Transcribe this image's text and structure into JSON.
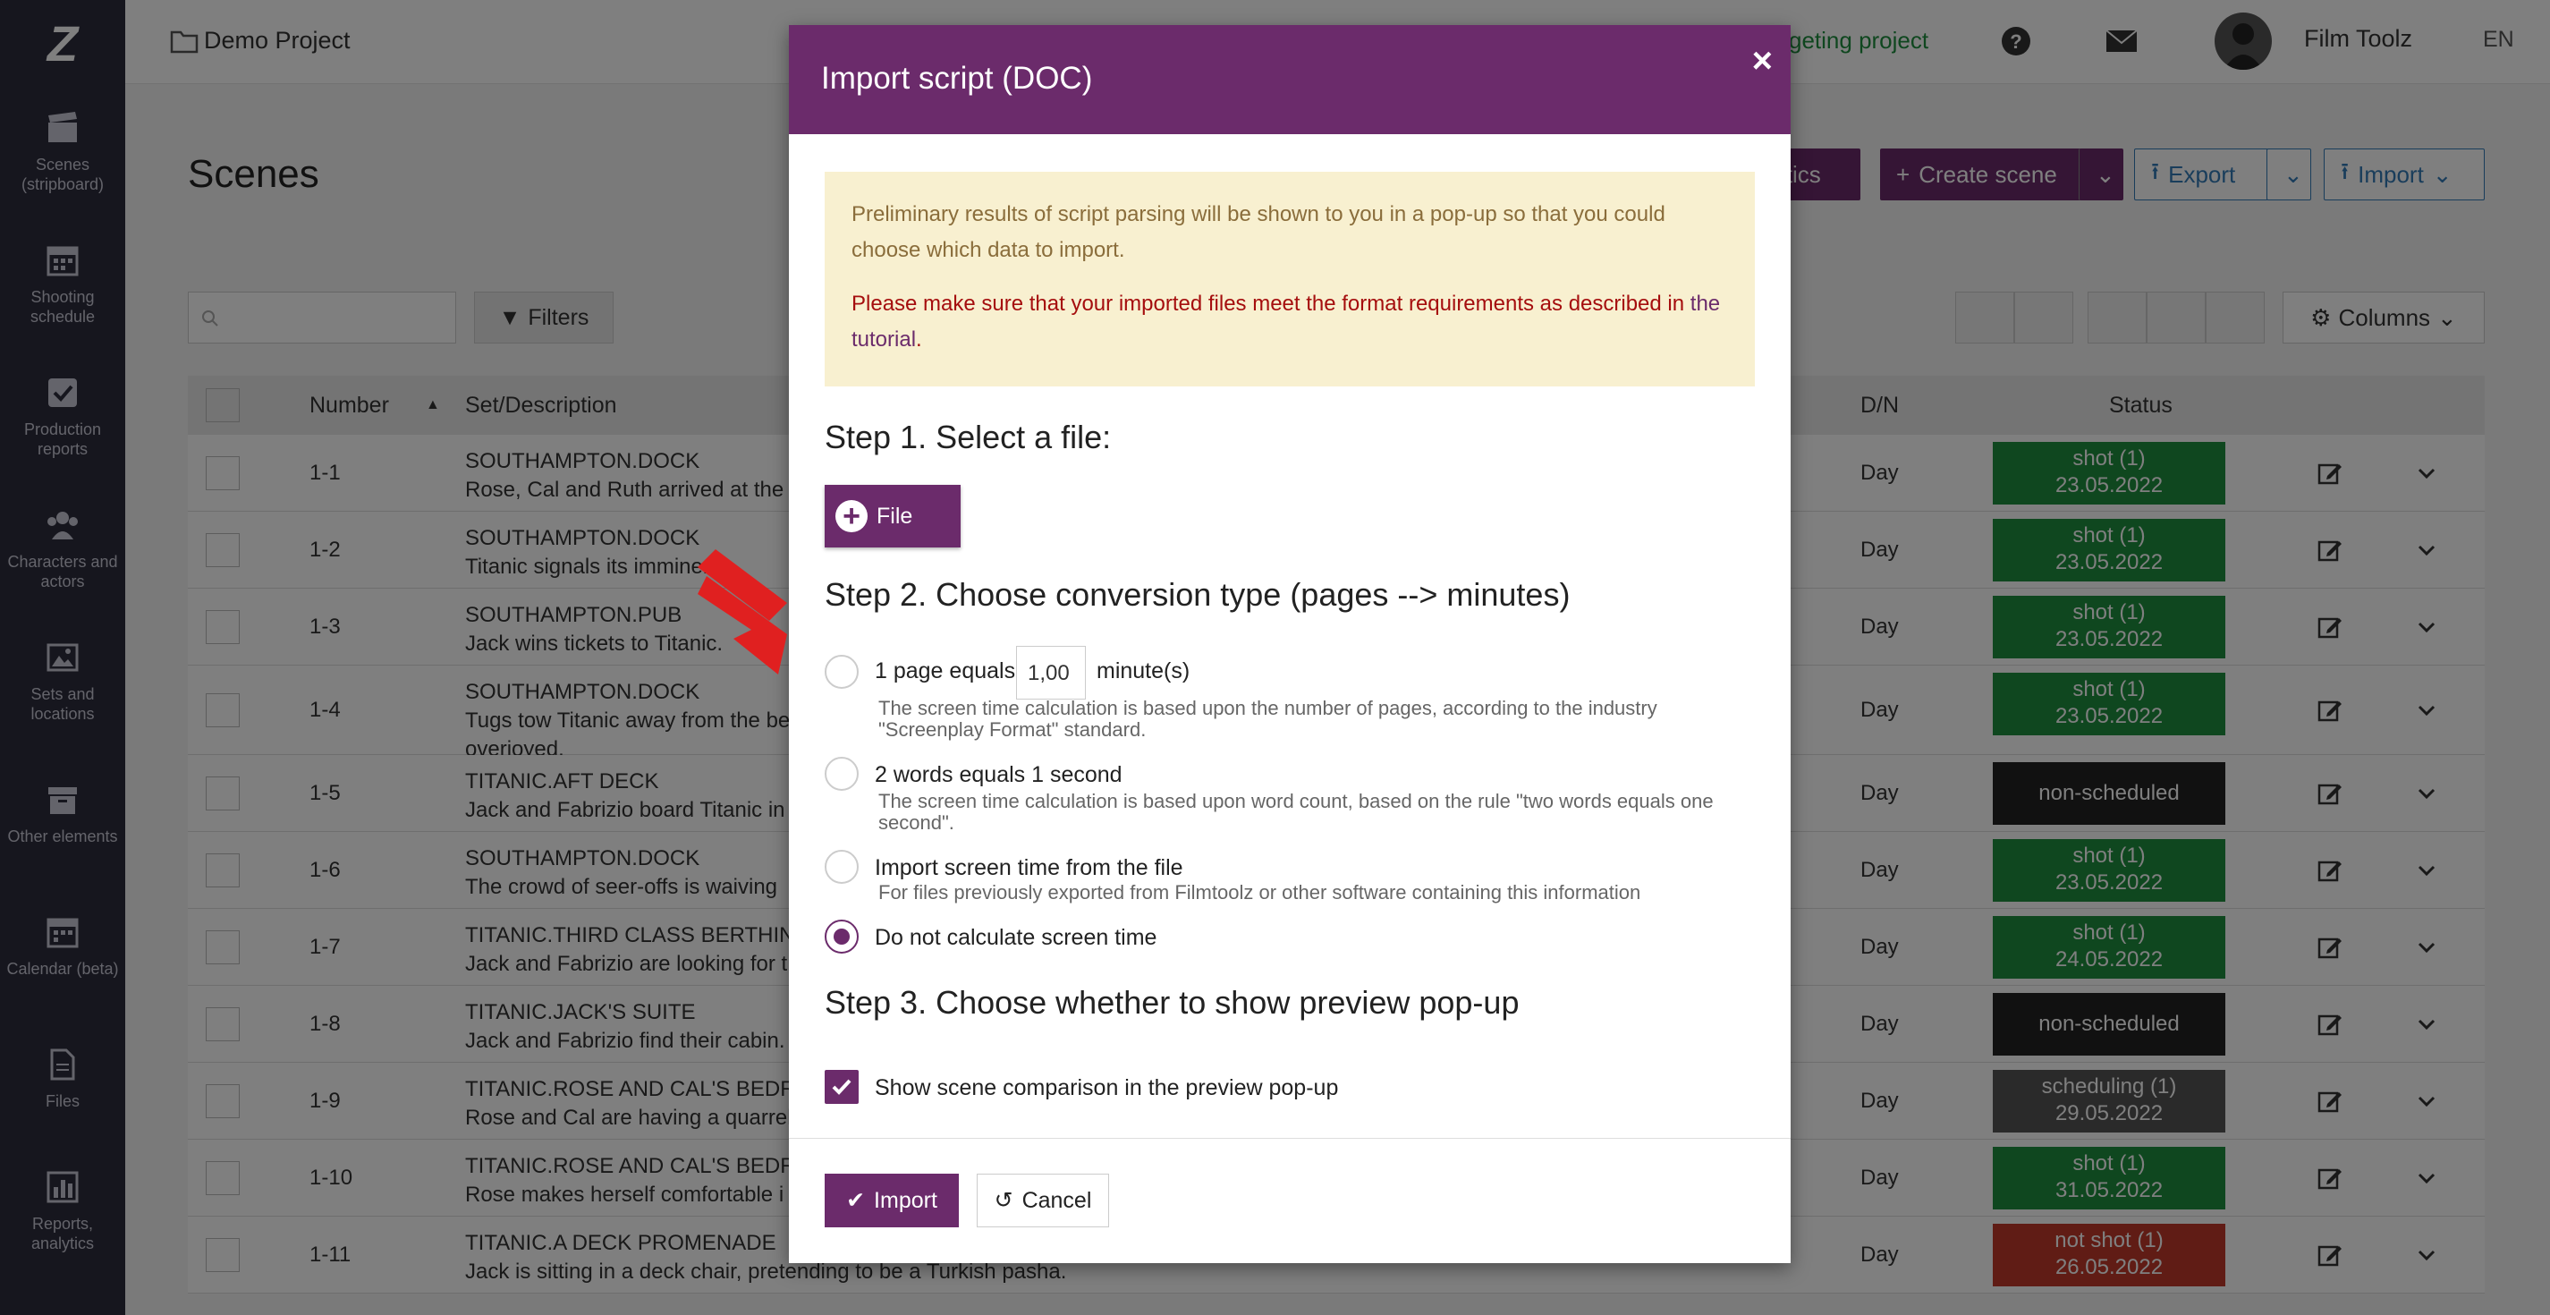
{
  "sidebar": {
    "logo": "Z",
    "items": [
      {
        "label": "Scenes (stripboard)",
        "icon": "clapperboard-icon"
      },
      {
        "label": "Shooting schedule",
        "icon": "calendar-icon"
      },
      {
        "label": "Production reports",
        "icon": "checkbox-icon"
      },
      {
        "label": "Characters and actors",
        "icon": "people-icon"
      },
      {
        "label": "Sets and locations",
        "icon": "picture-icon"
      },
      {
        "label": "Other elements",
        "icon": "archive-icon"
      },
      {
        "label": "Calendar (beta)",
        "icon": "calendar-icon"
      },
      {
        "label": "Files",
        "icon": "file-icon"
      },
      {
        "label": "Reports, analytics",
        "icon": "bar-chart-icon"
      }
    ]
  },
  "topbar": {
    "project": "Demo Project",
    "budget": "geting project",
    "user": "Film Toolz",
    "lang": "EN"
  },
  "main": {
    "title": "Scenes",
    "analytics_label": "lytics",
    "create_label": "Create scene",
    "export_label": "Export",
    "import_label": "Import",
    "filters_label": "Filters",
    "columns_label": "Columns",
    "headers": {
      "number": "Number",
      "set": "Set/Description",
      "dn": "D/N",
      "status": "Status"
    },
    "rows": [
      {
        "num": "1-1",
        "set": "SOUTHAMPTON.DOCK",
        "desc": "Rose, Cal and Ruth arrived at the b",
        "desc2": "",
        "dn": "Day",
        "status": "shot (1)",
        "date": "23.05.2022",
        "kind": "shot"
      },
      {
        "num": "1-2",
        "set": "SOUTHAMPTON.DOCK",
        "desc": "Titanic signals its imminent",
        "desc2": "",
        "dn": "Day",
        "status": "shot (1)",
        "date": "23.05.2022",
        "kind": "shot"
      },
      {
        "num": "1-3",
        "set": "SOUTHAMPTON.PUB",
        "desc": "Jack wins tickets to Titanic.",
        "desc2": "",
        "dn": "Day",
        "status": "shot (1)",
        "date": "23.05.2022",
        "kind": "shot"
      },
      {
        "num": "1-4",
        "set": "SOUTHAMPTON.DOCK",
        "desc": "Tugs tow Titanic away from the be",
        "desc2": "overjoyed.",
        "dn": "Day",
        "status": "shot (1)",
        "date": "23.05.2022",
        "kind": "shot"
      },
      {
        "num": "1-5",
        "set": "TITANIC.AFT DECK",
        "desc": "Jack and Fabrizio board Titanic in",
        "desc2": "",
        "dn": "Day",
        "status": "non-scheduled",
        "date": "",
        "kind": "non"
      },
      {
        "num": "1-6",
        "set": "SOUTHAMPTON.DOCK",
        "desc": "The crowd of seer-offs is waiving",
        "desc2": "",
        "dn": "Day",
        "status": "shot (1)",
        "date": "23.05.2022",
        "kind": "shot"
      },
      {
        "num": "1-7",
        "set": "TITANIC.THIRD CLASS BERTHING",
        "desc": "Jack and Fabrizio are looking for t",
        "desc2": "",
        "dn": "Day",
        "status": "shot (1)",
        "date": "24.05.2022",
        "kind": "shot"
      },
      {
        "num": "1-8",
        "set": "TITANIC.JACK'S SUITE",
        "desc": "Jack and Fabrizio find their cabin.",
        "desc2": "",
        "dn": "Day",
        "status": "non-scheduled",
        "date": "",
        "kind": "non"
      },
      {
        "num": "1-9",
        "set": "TITANIC.ROSE AND CAL'S BEDRO",
        "desc": "Rose and Cal are having a quarrel.",
        "desc2": "",
        "dn": "Day",
        "status": "scheduling (1)",
        "date": "29.05.2022",
        "kind": "sched"
      },
      {
        "num": "1-10",
        "set": "TITANIC.ROSE AND CAL'S BEDRO",
        "desc": "Rose makes herself comfortable i",
        "desc2": "",
        "dn": "Day",
        "status": "shot (1)",
        "date": "31.05.2022",
        "kind": "shot"
      },
      {
        "num": "1-11",
        "set": "TITANIC.A DECK PROMENADE",
        "desc": "Jack is sitting in a deck chair, pretending to be a Turkish pasha.",
        "desc2": "",
        "dn": "Day",
        "status": "not shot (1)",
        "date": "26.05.2022",
        "kind": "notshot"
      }
    ]
  },
  "modal": {
    "title": "Import script (DOC)",
    "close": "×",
    "alert_text": "Preliminary results of script parsing will be shown to you in a pop-up so that you could choose which data to import.",
    "alert_red": "Please make sure that your imported files meet the format requirements as described in ",
    "alert_link": "the tutorial",
    "alert_end": ".",
    "step1": "Step 1. Select a file:",
    "file_label": "File",
    "step2": "Step 2. Choose conversion type (pages --> minutes)",
    "opt1_a": "1 page equals",
    "opt1_value": "1,00",
    "opt1_b": "minute(s)",
    "opt1_help": "The screen time calculation is based upon the number of pages, according to the industry \"Screenplay Format\" standard.",
    "opt2": "2 words equals 1 second",
    "opt2_help": "The screen time calculation is based upon word count, based on the rule \"two words equals one second\".",
    "opt3": "Import screen time from the file",
    "opt3_help": "For files previously exported from Filmtoolz or other software containing this information",
    "opt4": "Do not calculate screen time",
    "step3": "Step 3. Choose whether to show preview pop-up",
    "check_label": "Show scene comparison in the preview pop-up",
    "import_btn": "Import",
    "cancel_btn": "Cancel"
  },
  "colors": {
    "primary": "#6b2b6b",
    "shot": "#1e8e3e",
    "notshot": "#c0392b",
    "accent_arrow": "#e02020"
  }
}
